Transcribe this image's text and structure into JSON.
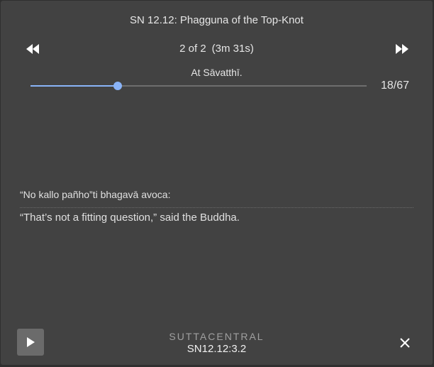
{
  "player": {
    "title": "SN 12.12: Phagguna of the Top-Knot",
    "track_position": "2 of 2",
    "track_duration": "(3m 31s)",
    "segment_caption": "At Sāvatthī.",
    "progress_fraction": 0.26,
    "segment_counter": "18/67",
    "pali_text": "“No kallo pañho”ti bhagavā avoca:",
    "english_text": "“That’s not a fitting question,” said the Buddha.",
    "brand": "SUTTACENTRAL",
    "reference": "SN12.12:3.2"
  },
  "icons": {
    "previous": "rewind-icon",
    "next": "fast-forward-icon",
    "play": "play-icon",
    "close": "close-icon"
  },
  "colors": {
    "background": "#424242",
    "accent": "#8ab4f8",
    "play_button": "#6b6b6b"
  }
}
